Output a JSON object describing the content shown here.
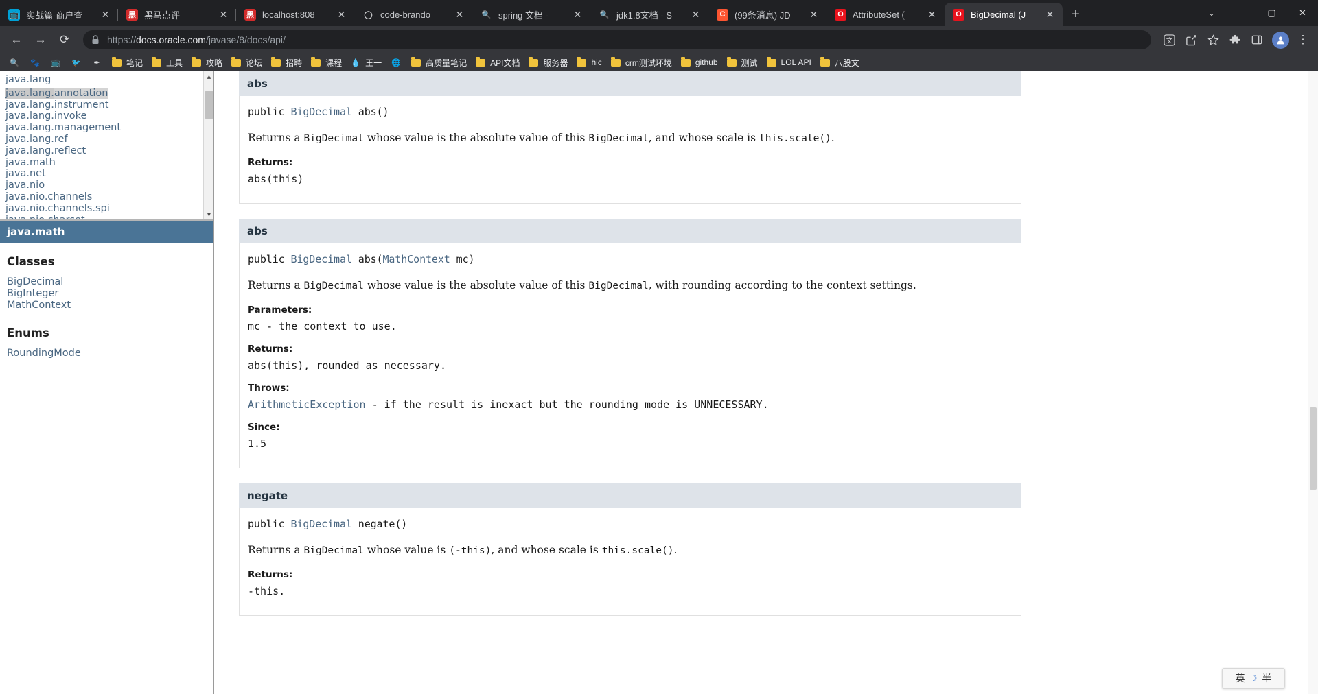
{
  "window": {
    "minimize": "—",
    "maximize": "▢",
    "close": "✕",
    "tab_search": "⌄"
  },
  "tabstrip": {
    "new_tab_label": "+",
    "tabs": [
      {
        "title": "实战篇-商户查",
        "favicon": "bilibili-icon",
        "favicon_glyph": "📺",
        "favicon_bg": "#00a1d6",
        "active": false,
        "close_label": "✕"
      },
      {
        "title": "黑马点评",
        "favicon": "heima-icon",
        "favicon_glyph": "黑",
        "favicon_bg": "#d22b2b",
        "active": false,
        "close_label": "✕"
      },
      {
        "title": "localhost:808",
        "favicon": "heima-icon",
        "favicon_glyph": "黑",
        "favicon_bg": "#d22b2b",
        "active": false,
        "close_label": "✕"
      },
      {
        "title": "code-brando",
        "favicon": "github-icon",
        "favicon_glyph": "◯",
        "favicon_bg": "transparent",
        "active": false,
        "close_label": "✕"
      },
      {
        "title": "spring 文档 -",
        "favicon": "search-icon",
        "favicon_glyph": "🔍",
        "favicon_bg": "transparent",
        "active": false,
        "close_label": "✕"
      },
      {
        "title": "jdk1.8文档 - S",
        "favicon": "search-icon",
        "favicon_glyph": "🔍",
        "favicon_bg": "transparent",
        "active": false,
        "close_label": "✕"
      },
      {
        "title": "(99条消息) JD",
        "favicon": "csdn-icon",
        "favicon_glyph": "C",
        "favicon_bg": "#fc5531",
        "active": false,
        "close_label": "✕"
      },
      {
        "title": "AttributeSet (",
        "favicon": "oracle-icon",
        "favicon_glyph": "O",
        "favicon_bg": "#e8131d",
        "active": false,
        "close_label": "✕"
      },
      {
        "title": "BigDecimal (J",
        "favicon": "oracle-icon",
        "favicon_glyph": "O",
        "favicon_bg": "#e8131d",
        "active": true,
        "close_label": "✕"
      }
    ]
  },
  "toolbar": {
    "back_label": "←",
    "forward_label": "→",
    "reload_label": "⟳",
    "lock_label": "lock-icon",
    "url_prefix": "https://",
    "url_host": "docs.oracle.com",
    "url_path": "/javase/8/docs/api/",
    "translate_label": "translate-icon",
    "share_label": "share-icon",
    "bookmark_label": "★",
    "extensions_label": "extensions-icon",
    "sidepanel_label": "▯",
    "profile_label": "●",
    "menu_label": "⋮"
  },
  "bookmarks": {
    "items": [
      {
        "label": "",
        "icon": "search-icon",
        "glyph": "🔍",
        "icon_only": true
      },
      {
        "label": "",
        "icon": "baidu-icon",
        "glyph": "🐾",
        "icon_only": true
      },
      {
        "label": "",
        "icon": "bilibili-icon",
        "glyph": "📺",
        "icon_only": true
      },
      {
        "label": "",
        "icon": "bird-icon",
        "glyph": "🐦",
        "icon_only": true
      },
      {
        "label": "",
        "icon": "pen-icon",
        "glyph": "✒",
        "icon_only": true
      },
      {
        "label": "笔记",
        "icon": "folder-icon",
        "glyph": "",
        "icon_only": false
      },
      {
        "label": "工具",
        "icon": "folder-icon",
        "glyph": "",
        "icon_only": false
      },
      {
        "label": "攻略",
        "icon": "folder-icon",
        "glyph": "",
        "icon_only": false
      },
      {
        "label": "论坛",
        "icon": "folder-icon",
        "glyph": "",
        "icon_only": false
      },
      {
        "label": "招聘",
        "icon": "folder-icon",
        "glyph": "",
        "icon_only": false
      },
      {
        "label": "课程",
        "icon": "folder-icon",
        "glyph": "",
        "icon_only": false
      },
      {
        "label": "王一",
        "icon": "water-drop-icon",
        "glyph": "💧",
        "icon_only": false
      },
      {
        "label": "",
        "icon": "globe-icon",
        "glyph": "🌐",
        "icon_only": true
      },
      {
        "label": "高质量笔记",
        "icon": "folder-icon",
        "glyph": "",
        "icon_only": false
      },
      {
        "label": "API文档",
        "icon": "folder-icon",
        "glyph": "",
        "icon_only": false
      },
      {
        "label": "服务器",
        "icon": "folder-icon",
        "glyph": "",
        "icon_only": false
      },
      {
        "label": "hic",
        "icon": "folder-icon",
        "glyph": "",
        "icon_only": false
      },
      {
        "label": "crm测试环境",
        "icon": "folder-icon",
        "glyph": "",
        "icon_only": false
      },
      {
        "label": "github",
        "icon": "folder-icon",
        "glyph": "",
        "icon_only": false
      },
      {
        "label": "测试",
        "icon": "folder-icon",
        "glyph": "",
        "icon_only": false
      },
      {
        "label": "LOL API",
        "icon": "folder-icon",
        "glyph": "",
        "icon_only": false
      },
      {
        "label": "八股文",
        "icon": "folder-icon",
        "glyph": "",
        "icon_only": false
      }
    ]
  },
  "package_frame": {
    "packages": [
      {
        "name": "java.lang",
        "selected": false
      },
      {
        "name": "java.lang.annotation",
        "selected": true
      },
      {
        "name": "java.lang.instrument",
        "selected": false
      },
      {
        "name": "java.lang.invoke",
        "selected": false
      },
      {
        "name": "java.lang.management",
        "selected": false
      },
      {
        "name": "java.lang.ref",
        "selected": false
      },
      {
        "name": "java.lang.reflect",
        "selected": false
      },
      {
        "name": "java.math",
        "selected": false
      },
      {
        "name": "java.net",
        "selected": false
      },
      {
        "name": "java.nio",
        "selected": false
      },
      {
        "name": "java.nio.channels",
        "selected": false
      },
      {
        "name": "java.nio.channels.spi",
        "selected": false
      },
      {
        "name": "java.nio.charset",
        "selected": false
      }
    ],
    "scroll_up": "▲",
    "scroll_down": "▼"
  },
  "class_frame": {
    "package_title": "java.math",
    "classes_heading": "Classes",
    "classes": [
      "BigDecimal",
      "BigInteger",
      "MathContext"
    ],
    "enums_heading": "Enums",
    "enums": [
      "RoundingMode"
    ]
  },
  "content": {
    "members": [
      {
        "anchor": "abs",
        "signature": {
          "modifier": "public",
          "return_type": "BigDecimal",
          "name": "abs",
          "params": "()"
        },
        "description": "Returns a BigDecimal whose value is the absolute value of this BigDecimal, and whose scale is this.scale().",
        "sections": [
          {
            "label": "Returns:",
            "value": "abs(this)"
          }
        ]
      },
      {
        "anchor": "abs",
        "signature": {
          "modifier": "public",
          "return_type": "BigDecimal",
          "name": "abs",
          "params": "(MathContext mc)"
        },
        "description": "Returns a BigDecimal whose value is the absolute value of this BigDecimal, with rounding according to the context settings.",
        "sections": [
          {
            "label": "Parameters:",
            "value": "mc - the context to use."
          },
          {
            "label": "Returns:",
            "value": "abs(this), rounded as necessary."
          },
          {
            "label": "Throws:",
            "value": "ArithmeticException - if the result is inexact but the rounding mode is UNNECESSARY.",
            "link_text": "ArithmeticException"
          },
          {
            "label": "Since:",
            "value": "1.5"
          }
        ]
      },
      {
        "anchor": "negate",
        "signature": {
          "modifier": "public",
          "return_type": "BigDecimal",
          "name": "negate",
          "params": "()"
        },
        "description": "Returns a BigDecimal whose value is (-this), and whose scale is this.scale().",
        "sections": [
          {
            "label": "Returns:",
            "value": "-this."
          }
        ]
      }
    ]
  },
  "ime": {
    "language": "英",
    "moon": "☽",
    "extra": "半"
  },
  "colors": {
    "chrome_bg": "#202124",
    "toolbar_bg": "#35363a",
    "accent_blue": "#4a6782",
    "header_bg": "#dee3e9",
    "pkg_title_bg": "#4a7496"
  }
}
